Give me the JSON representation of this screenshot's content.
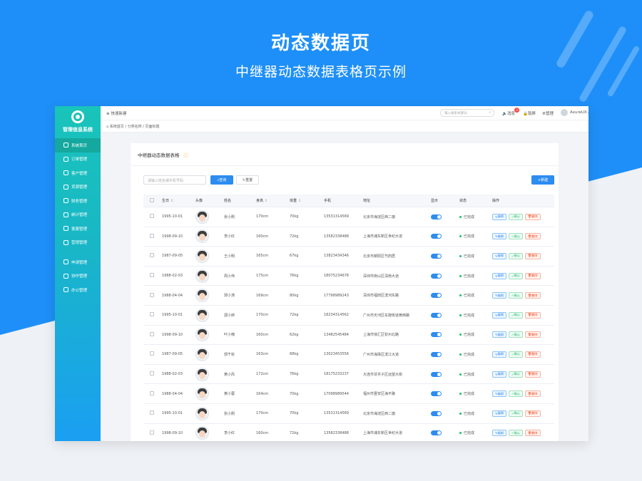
{
  "hero": {
    "title": "动态数据页",
    "subtitle": "中继器动态数据表格页示例"
  },
  "sidebar": {
    "logo_text": "管理信息系统",
    "items": [
      {
        "label": "系统首页",
        "active": true
      },
      {
        "label": "订单管理"
      },
      {
        "label": "客户管理"
      },
      {
        "label": "货源管理"
      },
      {
        "label": "财务管理"
      },
      {
        "label": "统计管理"
      },
      {
        "label": "客服管理"
      },
      {
        "label": "营销管理"
      },
      {
        "label": "申请管理"
      },
      {
        "label": "协作管理"
      },
      {
        "label": "办公管理"
      }
    ]
  },
  "topbar": {
    "quick_new": "⊕ 快速新建",
    "search_placeholder": "输入搜索关键词",
    "messages": "消息",
    "message_badge": "3",
    "lock": "锁屏",
    "settings": "管理",
    "user": "AxureUX"
  },
  "breadcrumb": {
    "text": "系统首页 / 分类名称 / 页面标题"
  },
  "card": {
    "title": "中继器动态数据表格",
    "filter_placeholder": "请输入姓名或手机号码",
    "query_label": "查询",
    "reset_label": "重置",
    "new_label": "新建"
  },
  "table": {
    "headers": [
      "生日",
      "头像",
      "姓名",
      "身高",
      "体重",
      "手机",
      "地址",
      "显示",
      "状态",
      "操作"
    ],
    "ops": {
      "edit": "编辑",
      "confirm": "确认",
      "delete": "删除"
    },
    "rows": [
      {
        "birth": "1995-10-01",
        "name": "张小刚",
        "height": "170cm",
        "weight": "70kg",
        "phone": "13531314569",
        "addr": "北京市海淀区西二旗",
        "status": "已完成"
      },
      {
        "birth": "1998-09-10",
        "name": "李小红",
        "height": "160cm",
        "weight": "72kg",
        "phone": "13582338488",
        "addr": "上海市浦东新区世纪大道",
        "status": "已完成"
      },
      {
        "birth": "1987-09-05",
        "name": "王小明",
        "height": "165cm",
        "weight": "67kg",
        "phone": "13823434346",
        "addr": "北京市朝阳区芍药居",
        "status": "已完成"
      },
      {
        "birth": "1988-02-03",
        "name": "周小伟",
        "height": "175cm",
        "weight": "76kg",
        "phone": "18075234678",
        "addr": "深圳市南山区深南大道",
        "status": "已完成"
      },
      {
        "birth": "1988-04-04",
        "name": "郭小涛",
        "height": "169cm",
        "weight": "80kg",
        "phone": "17798989243",
        "addr": "深圳市福田区滨河东路",
        "status": "已完成"
      },
      {
        "birth": "1995-10-01",
        "name": "邵小婷",
        "height": "170cm",
        "weight": "72kg",
        "phone": "18234314562",
        "addr": "广州市天河区车陂街道黄西路",
        "status": "已完成"
      },
      {
        "birth": "1998-09-10",
        "name": "叶小楠",
        "height": "160cm",
        "weight": "62kg",
        "phone": "13482545484",
        "addr": "上海市徐汇区钦州北路",
        "status": "已完成"
      },
      {
        "birth": "1987-09-05",
        "name": "郭千秋",
        "height": "163cm",
        "weight": "68kg",
        "phone": "13023453556",
        "addr": "广州市海珠区滨江大道",
        "status": "已完成"
      },
      {
        "birth": "1988-02-03",
        "name": "黄小风",
        "height": "172cm",
        "weight": "76kg",
        "phone": "18175233237",
        "addr": "大连市甘井子区远望大街",
        "status": "已完成"
      },
      {
        "birth": "1988-04-04",
        "name": "黄小蓉",
        "height": "164cm",
        "weight": "70kg",
        "phone": "17098989544",
        "addr": "福州市晋安区海平路",
        "status": "已完成"
      },
      {
        "birth": "1995-10-01",
        "name": "张小刚",
        "height": "170cm",
        "weight": "70kg",
        "phone": "13531314569",
        "addr": "北京市海淀区西二旗",
        "status": "已完成"
      },
      {
        "birth": "1998-09-10",
        "name": "李小红",
        "height": "160cm",
        "weight": "72kg",
        "phone": "13582338488",
        "addr": "上海市浦东新区世纪大道",
        "status": "已完成"
      }
    ]
  },
  "colors": {
    "primary": "#2d8cf0",
    "sidebar": "#19c4b9",
    "hero": "#1e8ff8"
  }
}
